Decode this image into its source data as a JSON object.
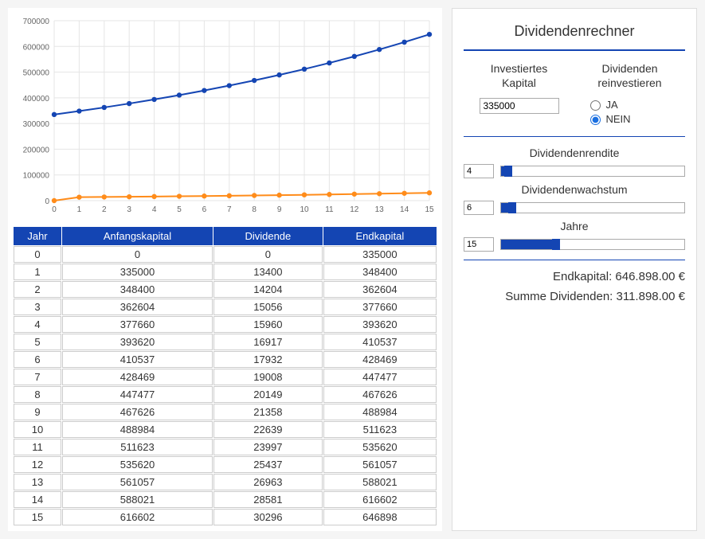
{
  "chart_data": {
    "type": "line",
    "x": [
      0,
      1,
      2,
      3,
      4,
      5,
      6,
      7,
      8,
      9,
      10,
      11,
      12,
      13,
      14,
      15
    ],
    "series": [
      {
        "name": "Endkapital",
        "color": "#1445b3",
        "values": [
          335000,
          348400,
          362604,
          377660,
          393620,
          410537,
          428469,
          447477,
          467626,
          488984,
          511623,
          535620,
          561057,
          588021,
          616602,
          646898
        ]
      },
      {
        "name": "Dividende",
        "color": "#ff8c1a",
        "values": [
          0,
          13400,
          14204,
          15056,
          15960,
          16917,
          17932,
          19008,
          20149,
          21358,
          22639,
          23997,
          25437,
          26963,
          28581,
          30296
        ]
      }
    ],
    "xlabel": "",
    "ylabel": "",
    "xlim": [
      0,
      15
    ],
    "ylim": [
      0,
      700000
    ],
    "yticks": [
      0,
      100000,
      200000,
      300000,
      400000,
      500000,
      600000,
      700000
    ],
    "title": ""
  },
  "table": {
    "headers": [
      "Jahr",
      "Anfangskapital",
      "Dividende",
      "Endkapital"
    ],
    "rows": [
      [
        0,
        0,
        0,
        335000
      ],
      [
        1,
        335000,
        13400,
        348400
      ],
      [
        2,
        348400,
        14204,
        362604
      ],
      [
        3,
        362604,
        15056,
        377660
      ],
      [
        4,
        377660,
        15960,
        393620
      ],
      [
        5,
        393620,
        16917,
        410537
      ],
      [
        6,
        410537,
        17932,
        428469
      ],
      [
        7,
        428469,
        19008,
        447477
      ],
      [
        8,
        447477,
        20149,
        467626
      ],
      [
        9,
        467626,
        21358,
        488984
      ],
      [
        10,
        488984,
        22639,
        511623
      ],
      [
        11,
        511623,
        23997,
        535620
      ],
      [
        12,
        535620,
        25437,
        561057
      ],
      [
        13,
        561057,
        26963,
        588021
      ],
      [
        14,
        588021,
        28581,
        616602
      ],
      [
        15,
        616602,
        30296,
        646898
      ]
    ]
  },
  "panel": {
    "title": "Dividendenrechner",
    "invested_label": "Investiertes Kapital",
    "invested_value": "335000",
    "reinvest_label": "Dividenden reinvestieren",
    "reinvest_yes": "JA",
    "reinvest_no": "NEIN",
    "reinvest_selected": "NEIN",
    "yield_label": "Dividendenrendite",
    "yield_value": "4",
    "yield_max": 100,
    "growth_label": "Dividendenwachstum",
    "growth_value": "6",
    "growth_max": 100,
    "years_label": "Jahre",
    "years_value": "15",
    "years_max": 50,
    "result_endcapital_label": "Endkapital:",
    "result_endcapital_value": "646.898.00 €",
    "result_divsum_label": "Summe Dividenden:",
    "result_divsum_value": "311.898.00 €"
  }
}
